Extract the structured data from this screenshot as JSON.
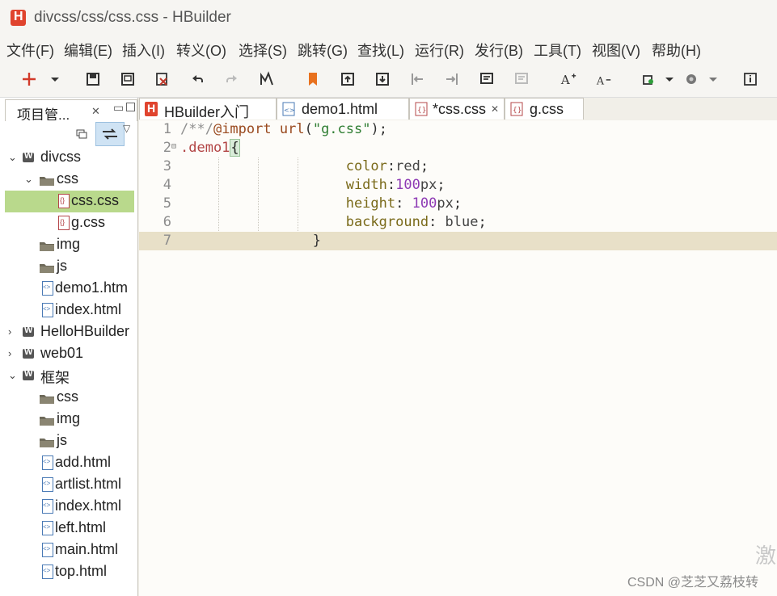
{
  "window": {
    "title": "divcss/css/css.css  -  HBuilder"
  },
  "menu": [
    "文件(F)",
    "编辑(E)",
    "插入(I)",
    "转义(O)",
    "选择(S)",
    "跳转(G)",
    "查找(L)",
    "运行(R)",
    "发行(B)",
    "工具(T)",
    "视图(V)",
    "帮助(H)"
  ],
  "project_panel": {
    "title": "项目管...",
    "tree": [
      {
        "label": "divcss",
        "type": "project",
        "expanded": true,
        "depth": 0
      },
      {
        "label": "css",
        "type": "folder",
        "expanded": true,
        "depth": 1
      },
      {
        "label": "css.css",
        "type": "css",
        "depth": 2,
        "selected": true
      },
      {
        "label": "g.css",
        "type": "css",
        "depth": 2
      },
      {
        "label": "img",
        "type": "folder",
        "depth": 1
      },
      {
        "label": "js",
        "type": "folder",
        "depth": 1
      },
      {
        "label": "demo1.htm",
        "type": "html",
        "depth": 1
      },
      {
        "label": "index.html",
        "type": "html",
        "depth": 1
      },
      {
        "label": "HelloHBuilder",
        "type": "project",
        "expanded": false,
        "depth": 0
      },
      {
        "label": "web01",
        "type": "project",
        "expanded": false,
        "depth": 0
      },
      {
        "label": "框架",
        "type": "project",
        "expanded": true,
        "depth": 0
      },
      {
        "label": "css",
        "type": "folder",
        "depth": 1
      },
      {
        "label": "img",
        "type": "folder",
        "depth": 1
      },
      {
        "label": "js",
        "type": "folder",
        "depth": 1
      },
      {
        "label": "add.html",
        "type": "html",
        "depth": 1
      },
      {
        "label": "artlist.html",
        "type": "html",
        "depth": 1
      },
      {
        "label": "index.html",
        "type": "html",
        "depth": 1
      },
      {
        "label": "left.html",
        "type": "html",
        "depth": 1
      },
      {
        "label": "main.html",
        "type": "html",
        "depth": 1
      },
      {
        "label": "top.html",
        "type": "html",
        "depth": 1
      }
    ]
  },
  "tabs": [
    {
      "label": "HBuilder入门",
      "icon": "hbuilder-icon"
    },
    {
      "label": "demo1.html",
      "icon": "html-file-icon"
    },
    {
      "label": "*css.css",
      "icon": "css-file-icon",
      "active": true
    },
    {
      "label": "g.css",
      "icon": "css-file-icon"
    }
  ],
  "editor": {
    "current_line": 7,
    "lines": [
      {
        "n": "1",
        "tokens": [
          [
            "comment",
            "/**/"
          ],
          [
            "kw",
            "@import"
          ],
          [
            "punc",
            " "
          ],
          [
            "fn",
            "url"
          ],
          [
            "punc",
            "("
          ],
          [
            "str",
            "\"g.css\""
          ],
          [
            "punc",
            ");"
          ]
        ]
      },
      {
        "n": "2",
        "fold": "⊟",
        "tokens": [
          [
            "sel",
            ".demo1"
          ],
          [
            "braceHl",
            "{"
          ]
        ]
      },
      {
        "n": "3",
        "tokens": [
          [
            "ws",
            "                    "
          ],
          [
            "prop",
            "color"
          ],
          [
            "punc",
            ":"
          ],
          [
            "val",
            "red"
          ],
          [
            "punc",
            ";"
          ]
        ]
      },
      {
        "n": "4",
        "tokens": [
          [
            "ws",
            "                    "
          ],
          [
            "prop",
            "width"
          ],
          [
            "punc",
            ":"
          ],
          [
            "num",
            "100"
          ],
          [
            "val",
            "px"
          ],
          [
            "punc",
            ";"
          ]
        ]
      },
      {
        "n": "5",
        "tokens": [
          [
            "ws",
            "                    "
          ],
          [
            "prop",
            "height"
          ],
          [
            "punc",
            ": "
          ],
          [
            "num",
            "100"
          ],
          [
            "val",
            "px"
          ],
          [
            "punc",
            ";"
          ]
        ]
      },
      {
        "n": "6",
        "tokens": [
          [
            "ws",
            "                    "
          ],
          [
            "prop",
            "background"
          ],
          [
            "punc",
            ": "
          ],
          [
            "val",
            "blue"
          ],
          [
            "punc",
            ";"
          ]
        ]
      },
      {
        "n": "7",
        "tokens": [
          [
            "ws",
            "                "
          ],
          [
            "punc",
            "}"
          ]
        ]
      }
    ]
  },
  "watermark": "CSDN @芝芝又荔枝转",
  "watermark_corner": "激"
}
